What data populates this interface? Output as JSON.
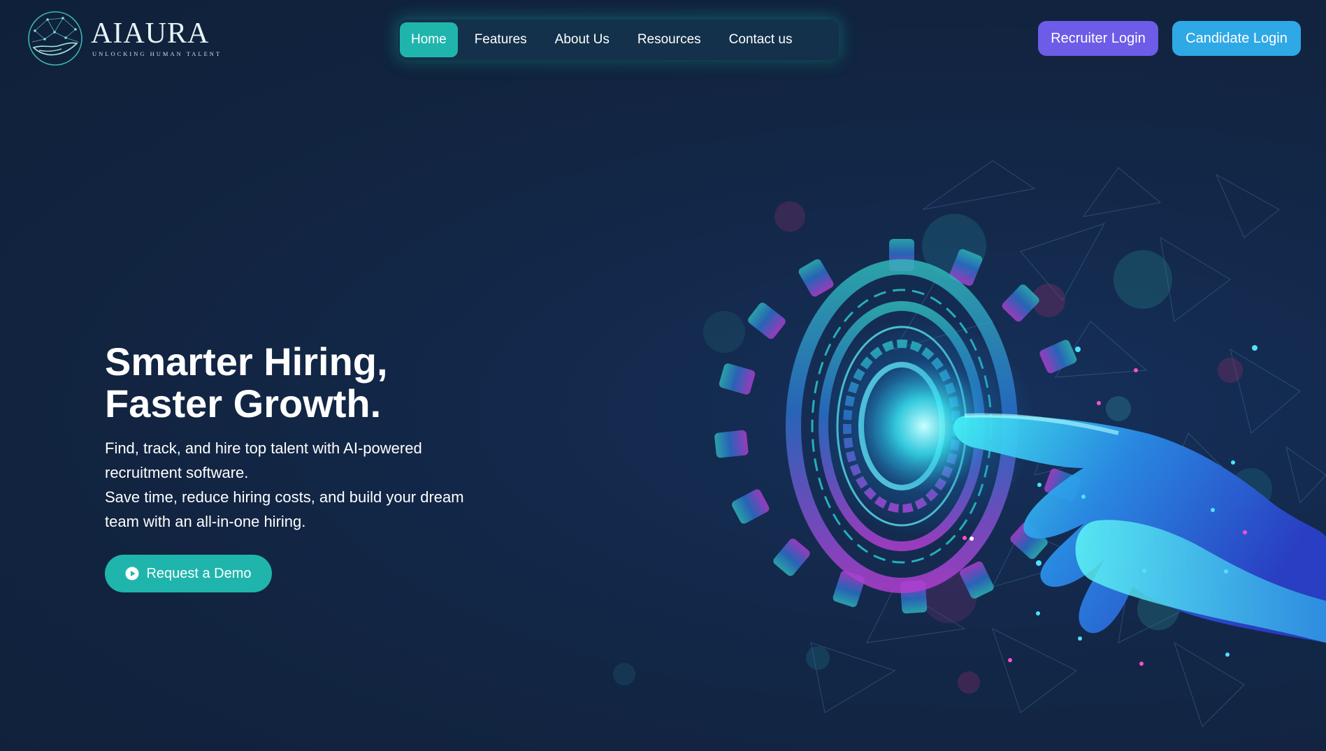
{
  "brand": {
    "name": "AIAURA",
    "tagline": "UNLOCKING  HUMAN  TALENT"
  },
  "nav": {
    "items": [
      {
        "label": "Home",
        "active": true
      },
      {
        "label": "Features",
        "active": false
      },
      {
        "label": "About Us",
        "active": false
      },
      {
        "label": "Resources",
        "active": false
      },
      {
        "label": "Contact us",
        "active": false
      }
    ]
  },
  "auth": {
    "recruiter_label": "Recruiter Login",
    "candidate_label": "Candidate Login"
  },
  "hero": {
    "title_line1": "Smarter Hiring,",
    "title_line2": "Faster Growth.",
    "subtitle_line1": "Find, track, and hire top talent with AI-powered",
    "subtitle_line2": "recruitment software.",
    "subtitle_line3": "Save time, reduce hiring costs, and build your dream",
    "subtitle_line4": "team with an all-in-one hiring.",
    "cta_label": "Request a Demo"
  },
  "colors": {
    "background": "#12253f",
    "accent_teal": "#1fb5ad",
    "recruiter_purple": "#6c5ce7",
    "candidate_blue": "#2fa8e6"
  },
  "icons": {
    "logo": "globe-hand-logo-icon",
    "cta": "play-circle-icon",
    "illustration": "gear-hand-illustration"
  }
}
